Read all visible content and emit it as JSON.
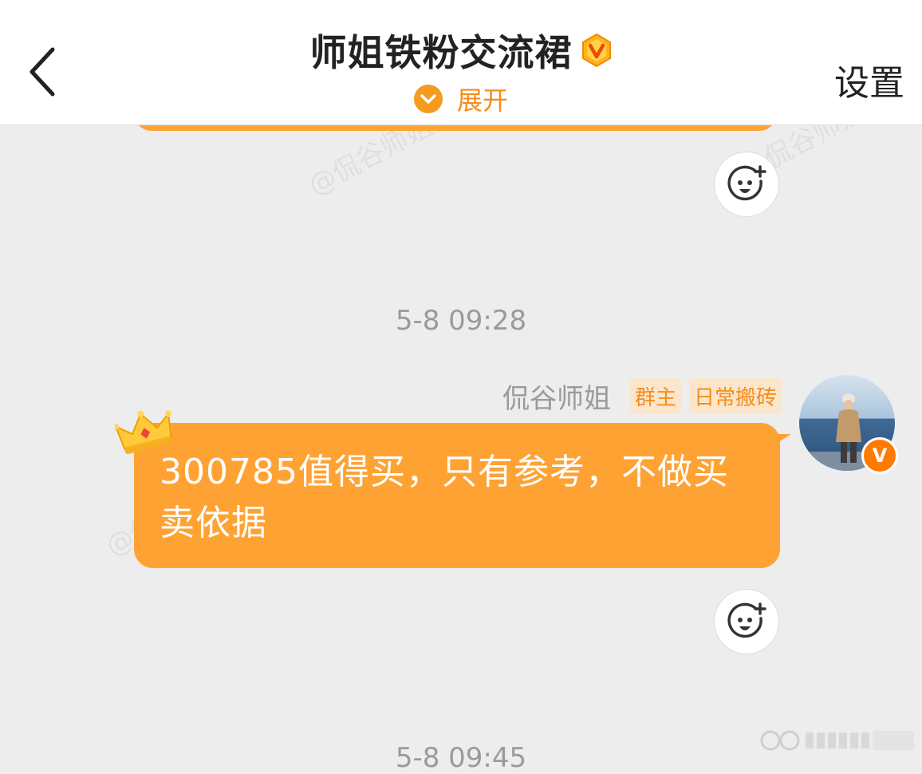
{
  "header": {
    "title": "师姐铁粉交流裙",
    "expand_label": "展开",
    "settings_label": "设置"
  },
  "watermark_text": "@侃谷师姐",
  "messages": [
    {
      "timestamp": "5-8 09:28",
      "sender": "侃谷师姐",
      "tags": [
        "群主",
        "日常搬砖"
      ],
      "text": "300785值得买，只有参考，不做买卖依据"
    }
  ],
  "next_timestamp": "5-8 09:45",
  "colors": {
    "accent": "#f58d1c",
    "bubble": "#ffa234",
    "background": "#ededed"
  },
  "icons": [
    "back-arrow-icon",
    "vip-badge-icon",
    "chevron-down-icon",
    "add-reaction-icon",
    "crown-icon",
    "verified-v-icon"
  ]
}
